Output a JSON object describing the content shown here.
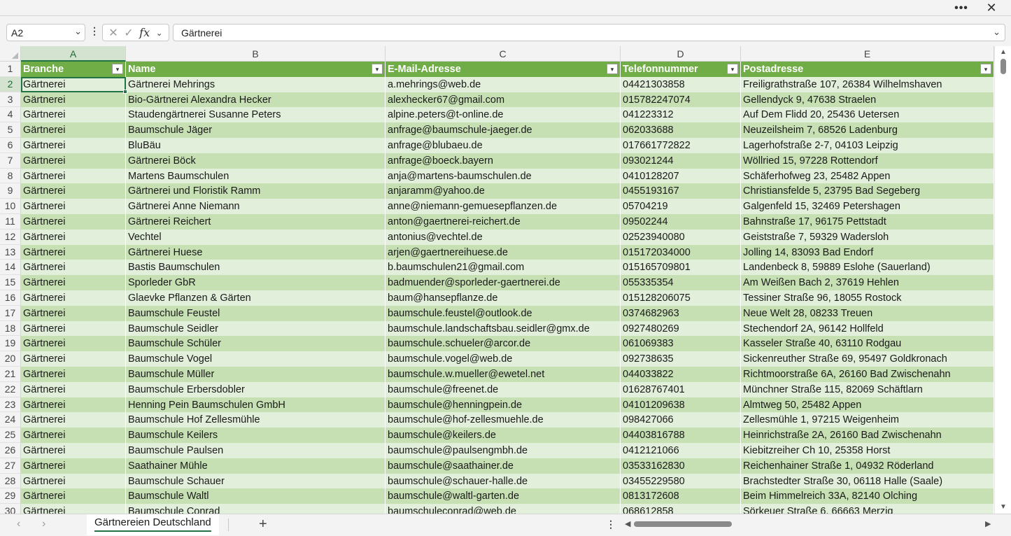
{
  "topbar": {
    "more_label": "•••",
    "close_label": "✕"
  },
  "formula_bar": {
    "name_box": "A2",
    "name_box_dropdown": "⌄",
    "more_label": "⋮",
    "cancel_label": "✕",
    "enter_label": "✓",
    "fx_label": "fx",
    "fx_dropdown": "⌄",
    "formula_value": "Gärtnerei",
    "expand_label": "⌄"
  },
  "columns": [
    "A",
    "B",
    "C",
    "D",
    "E"
  ],
  "selected_column": "A",
  "header_row": {
    "row_number": "1",
    "cells": [
      "Branche",
      "Name",
      "E-Mail-Adresse",
      "Telefonnummer",
      "Postadresse"
    ],
    "filter_label": "▾"
  },
  "rows": [
    {
      "n": "2",
      "cells": [
        "Gärtnerei",
        "Gärtnerei Mehrings",
        "a.mehrings@web.de",
        "04421303858",
        "Freiligrathstraße 107, 26384 Wilhelmshaven"
      ]
    },
    {
      "n": "3",
      "cells": [
        "Gärtnerei",
        "Bio-Gärtnerei Alexandra Hecker",
        "alexhecker67@gmail.com",
        "015782247074",
        "Gellendyck 9, 47638 Straelen"
      ]
    },
    {
      "n": "4",
      "cells": [
        "Gärtnerei",
        "Staudengärtnerei Susanne Peters",
        "alpine.peters@t-online.de",
        "041223312",
        "Auf Dem Flidd 20, 25436 Uetersen"
      ]
    },
    {
      "n": "5",
      "cells": [
        "Gärtnerei",
        "Baumschule Jäger",
        "anfrage@baumschule-jaeger.de",
        "062033688",
        "Neuzeilsheim 7, 68526 Ladenburg"
      ]
    },
    {
      "n": "6",
      "cells": [
        "Gärtnerei",
        "BluBäu",
        "anfrage@blubaeu.de",
        "017661772822",
        "Lagerhofstraße 2-7, 04103 Leipzig"
      ]
    },
    {
      "n": "7",
      "cells": [
        "Gärtnerei",
        "Gärtnerei Böck",
        "anfrage@boeck.bayern",
        "093021244",
        "Wöllried 15, 97228 Rottendorf"
      ]
    },
    {
      "n": "8",
      "cells": [
        "Gärtnerei",
        "Martens Baumschulen",
        "anja@martens-baumschulen.de",
        "0410128207",
        "Schäferhofweg 23, 25482 Appen"
      ]
    },
    {
      "n": "9",
      "cells": [
        "Gärtnerei",
        "Gärtnerei und Floristik Ramm",
        "anjaramm@yahoo.de",
        "0455193167",
        "Christiansfelde 5, 23795 Bad Segeberg"
      ]
    },
    {
      "n": "10",
      "cells": [
        "Gärtnerei",
        "Gärtnerei Anne Niemann",
        "anne@niemann-gemuesepflanzen.de",
        "05704219",
        "Galgenfeld 15, 32469 Petershagen"
      ]
    },
    {
      "n": "11",
      "cells": [
        "Gärtnerei",
        "Gärtnerei Reichert",
        "anton@gaertnerei-reichert.de",
        "09502244",
        "Bahnstraße 17, 96175 Pettstadt"
      ]
    },
    {
      "n": "12",
      "cells": [
        "Gärtnerei",
        "Vechtel",
        "antonius@vechtel.de",
        "02523940080",
        "Geiststraße 7, 59329 Wadersloh"
      ]
    },
    {
      "n": "13",
      "cells": [
        "Gärtnerei",
        "Gärtnerei Huese",
        "arjen@gaertnereihuese.de",
        "015172034000",
        "Jolling 14, 83093 Bad Endorf"
      ]
    },
    {
      "n": "14",
      "cells": [
        "Gärtnerei",
        "Bastis Baumschulen",
        "b.baumschulen21@gmail.com",
        "015165709801",
        "Landenbeck 8, 59889 Eslohe (Sauerland)"
      ]
    },
    {
      "n": "15",
      "cells": [
        "Gärtnerei",
        "Sporleder GbR",
        "badmuender@sporleder-gaertnerei.de",
        "055335354",
        "Am Weißen Bach 2, 37619 Hehlen"
      ]
    },
    {
      "n": "16",
      "cells": [
        "Gärtnerei",
        "Glaevke Pflanzen & Gärten",
        "baum@hansepflanze.de",
        "015128206075",
        "Tessiner Straße 96, 18055 Rostock"
      ]
    },
    {
      "n": "17",
      "cells": [
        "Gärtnerei",
        "Baumschule Feustel",
        "baumschule.feustel@outlook.de",
        "0374682963",
        "Neue Welt 28, 08233 Treuen"
      ]
    },
    {
      "n": "18",
      "cells": [
        "Gärtnerei",
        "Baumschule Seidler",
        "baumschule.landschaftsbau.seidler@gmx.de",
        "0927480269",
        "Stechendorf 2A, 96142 Hollfeld"
      ]
    },
    {
      "n": "19",
      "cells": [
        "Gärtnerei",
        "Baumschule Schüler",
        "baumschule.schueler@arcor.de",
        "061069383",
        "Kasseler Straße 40, 63110 Rodgau"
      ]
    },
    {
      "n": "20",
      "cells": [
        "Gärtnerei",
        "Baumschule Vogel",
        "baumschule.vogel@web.de",
        "092738635",
        "Sickenreuther Straße 69, 95497 Goldkronach"
      ]
    },
    {
      "n": "21",
      "cells": [
        "Gärtnerei",
        "Baumschule Müller",
        "baumschule.w.mueller@ewetel.net",
        "044033822",
        "Richtmoorstraße 6A, 26160 Bad Zwischenahn"
      ]
    },
    {
      "n": "22",
      "cells": [
        "Gärtnerei",
        "Baumschule Erbersdobler",
        "baumschule@freenet.de",
        "01628767401",
        "Münchner Straße 115, 82069 Schäftlarn"
      ]
    },
    {
      "n": "23",
      "cells": [
        "Gärtnerei",
        "Henning Pein Baumschulen GmbH",
        "baumschule@henningpein.de",
        "04101209638",
        "Almtweg 50, 25482 Appen"
      ]
    },
    {
      "n": "24",
      "cells": [
        "Gärtnerei",
        "Baumschule Hof Zellesmühle",
        "baumschule@hof-zellesmuehle.de",
        "098427066",
        "Zellesmühle 1, 97215 Weigenheim"
      ]
    },
    {
      "n": "25",
      "cells": [
        "Gärtnerei",
        "Baumschule Keilers",
        "baumschule@keilers.de",
        "04403816788",
        "Heinrichstraße 2A, 26160 Bad Zwischenahn"
      ]
    },
    {
      "n": "26",
      "cells": [
        "Gärtnerei",
        "Baumschule Paulsen",
        "baumschule@paulsengmbh.de",
        "0412121066",
        "Kiebitzreiher Ch 10, 25358 Horst"
      ]
    },
    {
      "n": "27",
      "cells": [
        "Gärtnerei",
        "Saathainer Mühle",
        "baumschule@saathainer.de",
        "03533162830",
        "Reichenhainer Straße 1, 04932 Röderland"
      ]
    },
    {
      "n": "28",
      "cells": [
        "Gärtnerei",
        "Baumschule Schauer",
        "baumschule@schauer-halle.de",
        "03455229580",
        "Brachstedter Straße 30, 06118 Halle (Saale)"
      ]
    },
    {
      "n": "29",
      "cells": [
        "Gärtnerei",
        "Baumschule Waltl",
        "baumschule@waltl-garten.de",
        "0813172608",
        "Beim Himmelreich 33A, 82140 Olching"
      ]
    },
    {
      "n": "30",
      "cells": [
        "Gärtnerei",
        "Baumschule Conrad",
        "baumschuleconrad@web.de",
        "068612858",
        "Sörkeuer Straße 6, 66663 Merzig"
      ]
    }
  ],
  "sheet_tabs": {
    "prev_label": "‹",
    "next_label": "›",
    "active_tab": "Gärtnereien Deutschland",
    "add_label": "+",
    "more_label": "⋮",
    "scroll_left_label": "◀",
    "scroll_right_label": "▶"
  },
  "scroll": {
    "up_label": "▲",
    "down_label": "▼"
  },
  "colors": {
    "header_green": "#70ad47",
    "band_dark": "#c6e0b4",
    "band_light": "#e2efda",
    "accent": "#217346"
  }
}
